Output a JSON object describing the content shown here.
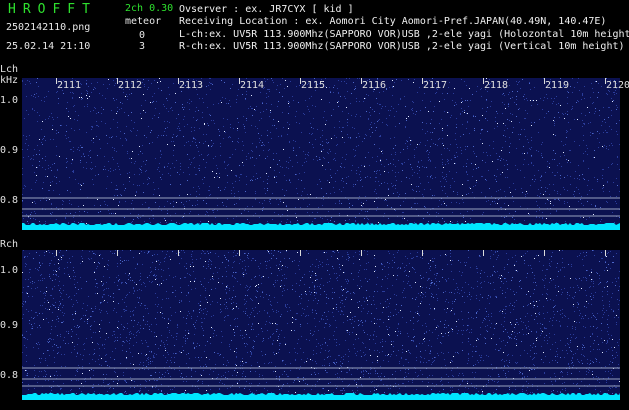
{
  "header": {
    "app_title": "HROFFT",
    "mode": "2ch 0.30",
    "file_name": "2502142110.png",
    "meteor_label": "meteor",
    "datetime": "25.02.14 21:10",
    "lch_count": "0",
    "rch_count": "3",
    "observer_line": "Ovserver              : ex. JR7CYX [ kid ]",
    "location_line": "Receiving Location : ex. Aomori City Aomori-Pref.JAPAN(40.49N, 140.47E)",
    "lch_line": "L-ch:ex. UV5R 113.900Mhz(SAPPORO VOR)USB ,2-ele yagi (Holozontal 10m height)",
    "rch_line": "R-ch:ex. UV5R 113.900Mhz(SAPPORO VOR)USB ,2-ele yagi (Vertical 10m height)"
  },
  "left_channel": {
    "label": "Lch",
    "unit": "kHz",
    "y_ticks": [
      "1.0",
      "0.9",
      "0.8"
    ]
  },
  "right_channel": {
    "label": "Rch",
    "y_ticks": [
      "1.0",
      "0.9",
      "0.8"
    ]
  },
  "time_ticks": [
    "2111",
    "2112",
    "2113",
    "2114",
    "2115",
    "2116",
    "2117",
    "2118",
    "2119",
    "2120"
  ],
  "colors": {
    "background": "#000000",
    "waterfall": "#0b1150",
    "noise_floor": "#00e5ff",
    "title": "#2ee02e"
  }
}
